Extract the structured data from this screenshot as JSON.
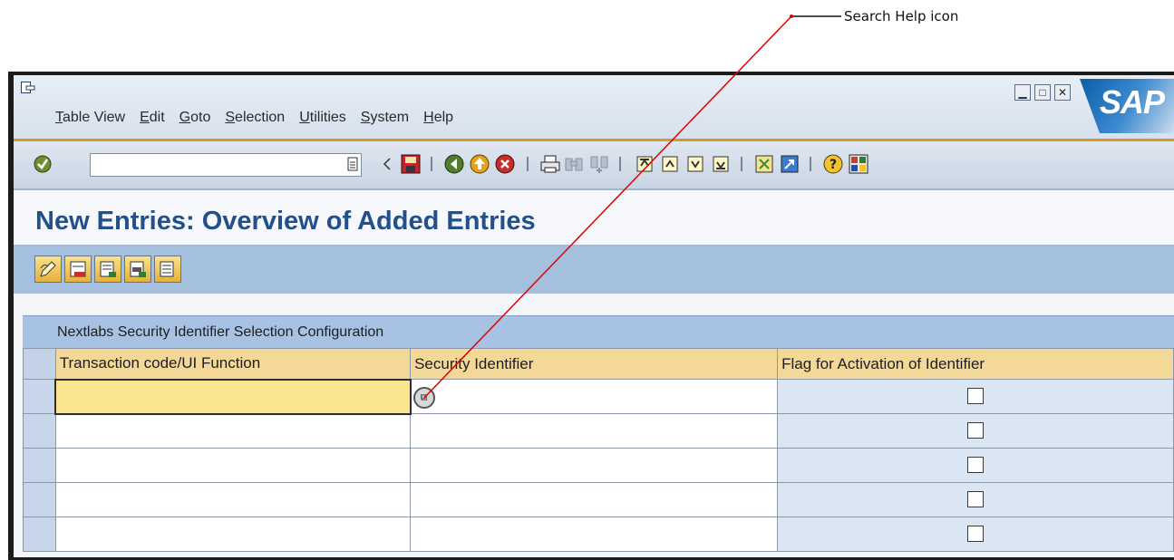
{
  "callout": {
    "label": "Search Help icon"
  },
  "window": {
    "menu": [
      "Table View",
      "Edit",
      "Goto",
      "Selection",
      "Utilities",
      "System",
      "Help"
    ],
    "logo_text": "SAP",
    "window_controls": [
      "minimize",
      "maximize",
      "close"
    ]
  },
  "toolbar": {
    "command_field": {
      "value": "",
      "placeholder": ""
    },
    "icons": [
      "enter-icon",
      "command-field-history-icon",
      "back-arrow-icon",
      "save-icon",
      "back-icon",
      "exit-icon",
      "cancel-icon",
      "print-icon",
      "find-icon",
      "find-next-icon",
      "first-page-icon",
      "previous-page-icon",
      "next-page-icon",
      "last-page-icon",
      "create-session-icon",
      "shortcut-icon",
      "help-icon",
      "layout-icon"
    ]
  },
  "page_title": "New Entries: Overview of Added Entries",
  "app_toolbar": {
    "buttons": [
      "change-icon",
      "delete-row-icon",
      "select-all-icon",
      "select-block-icon",
      "deselect-all-icon"
    ]
  },
  "table": {
    "title": "Nextlabs Security Identifier Selection Configuration",
    "columns": [
      "Transaction code/UI Function",
      "Security Identifier",
      "Flag for Activation of Identifier"
    ],
    "rows": [
      {
        "tcode": "",
        "security_identifier": "",
        "flag": false
      },
      {
        "tcode": "",
        "security_identifier": "",
        "flag": false
      },
      {
        "tcode": "",
        "security_identifier": "",
        "flag": false
      },
      {
        "tcode": "",
        "security_identifier": "",
        "flag": false
      },
      {
        "tcode": "",
        "security_identifier": "",
        "flag": false
      }
    ]
  },
  "colors": {
    "title": "#22508a",
    "header": "#f3d897",
    "active_cell": "#fbe48f",
    "app_toolbar": "#a5bfdf",
    "callout_line": "#e00000"
  }
}
